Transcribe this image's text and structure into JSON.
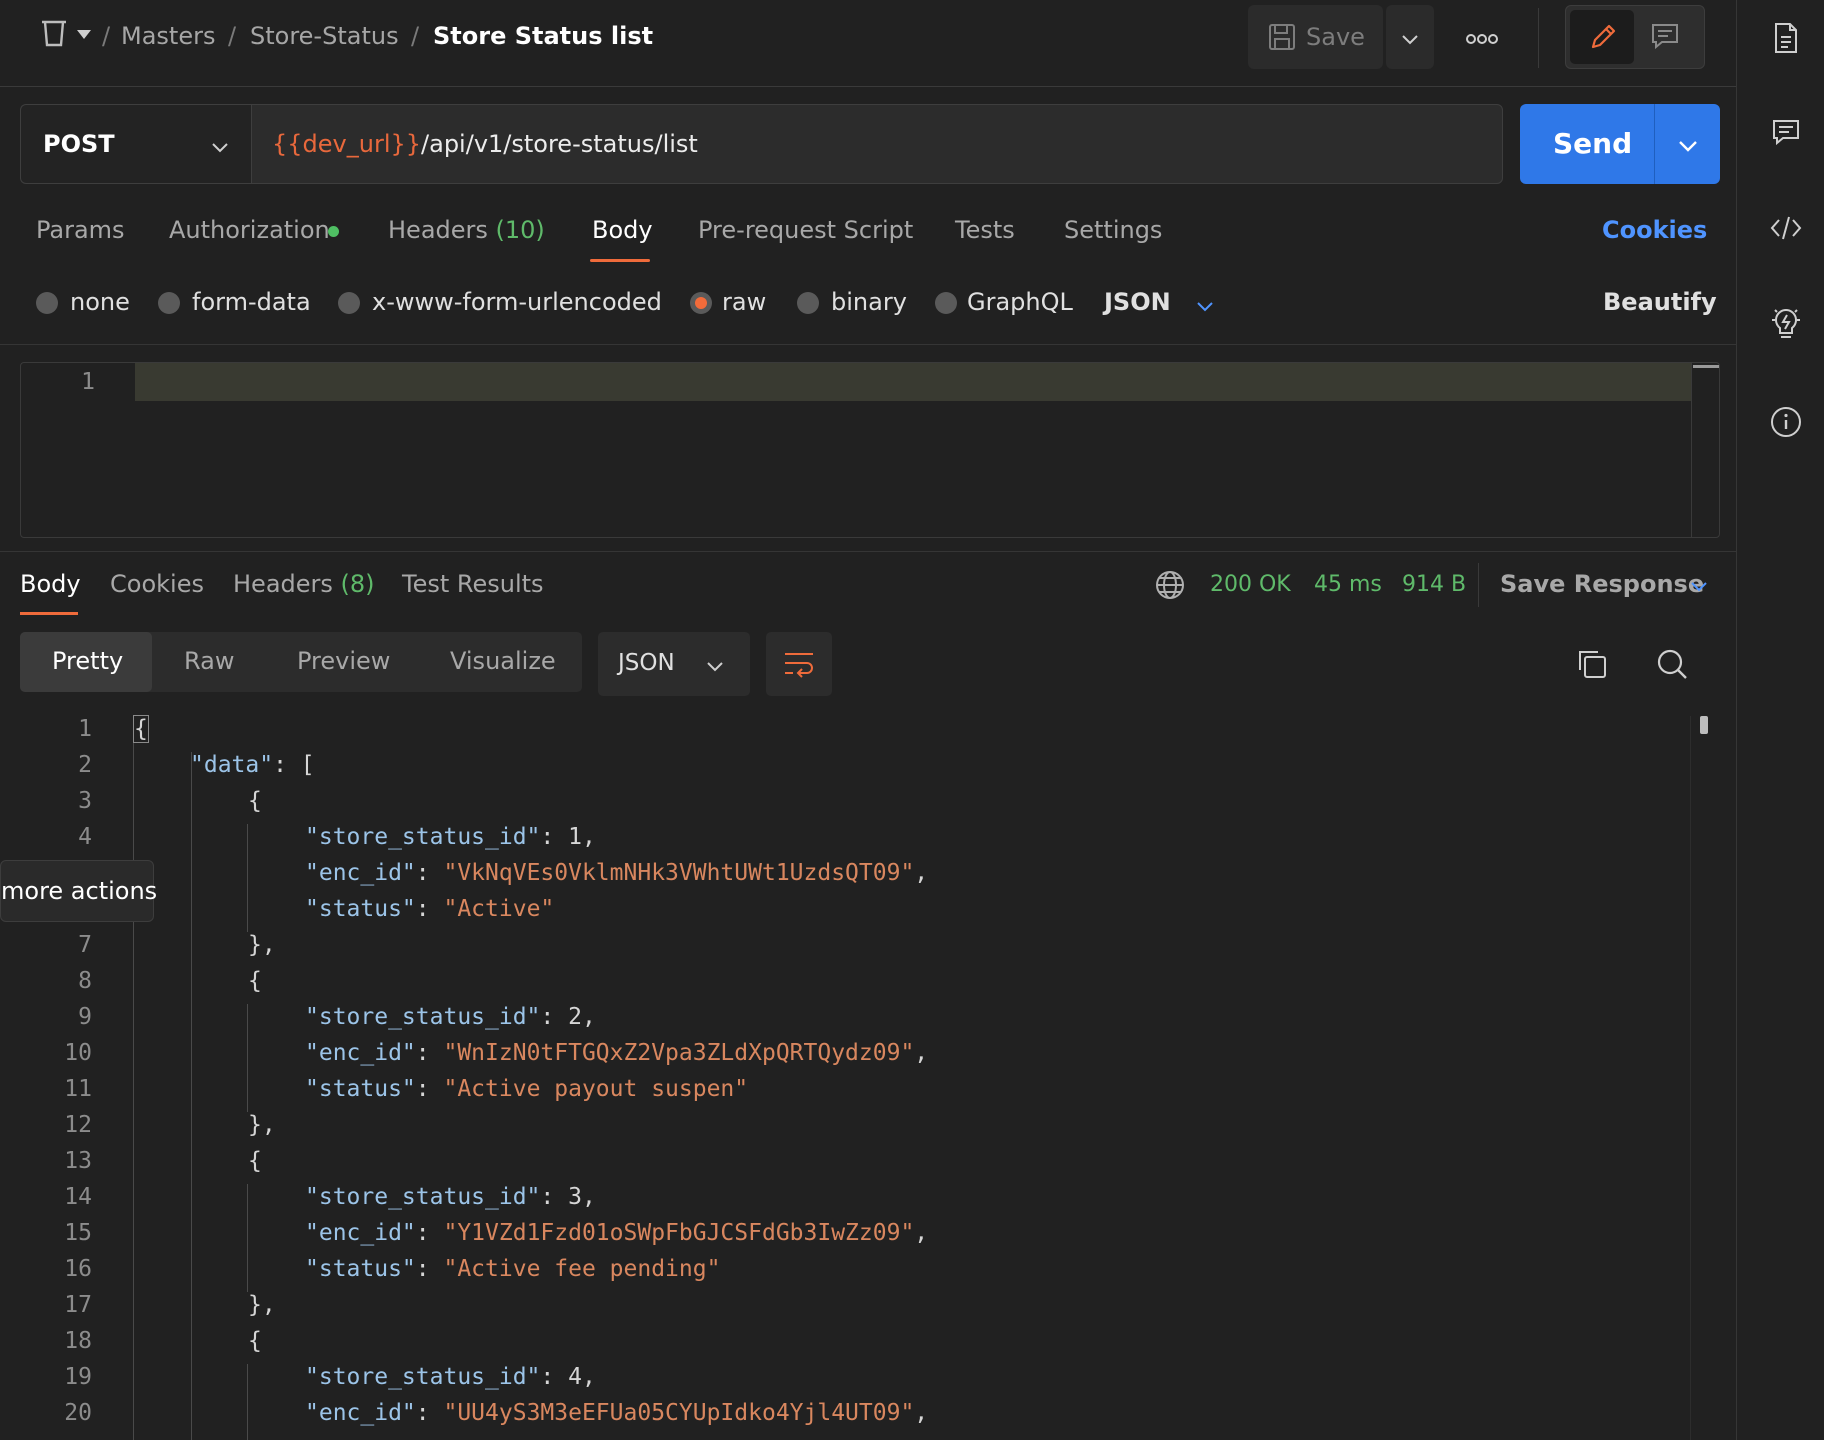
{
  "breadcrumb": {
    "items": [
      "Masters",
      "Store-Status"
    ],
    "separator": "/",
    "current": "Store Status list"
  },
  "toolbar": {
    "save_label": "Save",
    "more_icon": "ooo"
  },
  "request": {
    "method": "POST",
    "url_variable": "{{dev_url}}",
    "url_path": "/api/v1/store-status/list",
    "send_label": "Send"
  },
  "request_tabs": {
    "params": "Params",
    "authorization": "Authorization",
    "headers": "Headers",
    "headers_count": "(10)",
    "body": "Body",
    "prerequest": "Pre-request Script",
    "tests": "Tests",
    "settings": "Settings",
    "cookies": "Cookies"
  },
  "body_modes": {
    "none": "none",
    "form_data": "form-data",
    "urlencoded": "x-www-form-urlencoded",
    "raw": "raw",
    "binary": "binary",
    "graphql": "GraphQL",
    "format": "JSON",
    "beautify": "Beautify",
    "selected": "raw"
  },
  "request_editor": {
    "line_numbers": [
      "1"
    ]
  },
  "response_tabs": {
    "body": "Body",
    "cookies": "Cookies",
    "headers": "Headers",
    "headers_count": "(8)",
    "test_results": "Test Results"
  },
  "response_meta": {
    "status": "200 OK",
    "time": "45 ms",
    "size": "914 B",
    "save_response": "Save Response"
  },
  "view_modes": {
    "pretty": "Pretty",
    "raw": "Raw",
    "preview": "Preview",
    "visualize": "Visualize",
    "format": "JSON"
  },
  "tooltip": "more actions",
  "response_body": {
    "line_numbers": [
      "1",
      "2",
      "3",
      "4",
      "",
      "",
      "7",
      "8",
      "9",
      "10",
      "11",
      "12",
      "13",
      "14",
      "15",
      "16",
      "17",
      "18",
      "19",
      "20"
    ],
    "open_brace": "{",
    "data_key": "\"data\"",
    "colon": ": ",
    "open_bracket": "[",
    "obj_open": "{",
    "obj_close": "},",
    "comma": ",",
    "k_id": "\"store_status_id\"",
    "k_enc": "\"enc_id\"",
    "k_status": "\"status\"",
    "records": [
      {
        "id": "1",
        "enc_id": "\"VkNqVEs0VklmNHk3VWhtUWt1UzdsQT09\"",
        "status": "\"Active\""
      },
      {
        "id": "2",
        "enc_id": "\"WnIzN0tFTGQxZ2Vpa3ZLdXpQRTQydz09\"",
        "status": "\"Active payout suspen\""
      },
      {
        "id": "3",
        "enc_id": "\"Y1VZd1Fzd01oSWpFbGJCSFdGb3IwZz09\"",
        "status": "\"Active fee pending\""
      },
      {
        "id": "4",
        "enc_id": "\"UU4yS3M3eEFUa05CYUpIdko4Yjl4UT09\""
      }
    ]
  },
  "colors": {
    "accent_orange": "#ef6b3b",
    "send_blue": "#2f78e8",
    "link_blue": "#4f94ff",
    "status_green": "#5fba6a",
    "json_key": "#9cc4e8",
    "json_string": "#d9875f"
  },
  "icons": {
    "collection": "trash-bin-icon",
    "rail": [
      "document-icon",
      "comment-icon",
      "code-icon",
      "lightbulb-icon",
      "info-icon"
    ]
  }
}
